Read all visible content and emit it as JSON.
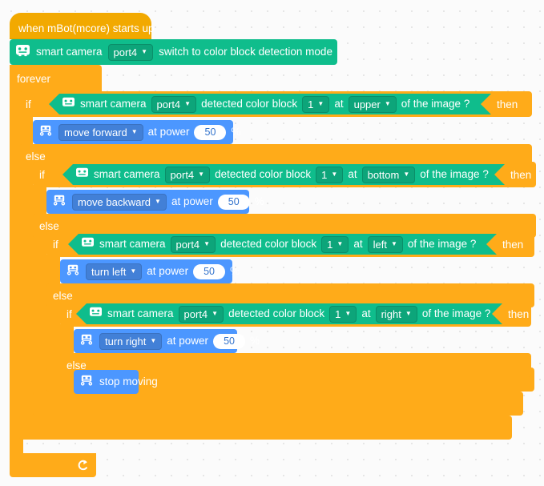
{
  "workspace": {
    "name": "mblock-block-workspace",
    "background": "#fbfbfb",
    "grid_dot_color": "#e2e2e2"
  },
  "colors": {
    "hat_orange": "#F2A900",
    "control_orange": "#FFAB19",
    "sensing_green": "#0FBD8C",
    "sensing_green_field": "#0DA57A",
    "motion_blue": "#4C97FF",
    "motion_blue_field": "#4280D7",
    "number_text": "#3373CC",
    "block_text": "#FFFFFF"
  },
  "script": {
    "hat": {
      "label": "when mBot(mcore) starts up",
      "icon": "none"
    },
    "setup_block": {
      "icon": "smart-camera-icon",
      "device_label": "smart camera",
      "port": "port4",
      "port_caret": "▼",
      "action_label": "switch to color block detection mode"
    },
    "forever": {
      "label": "forever",
      "repeat_icon": "loop-arrow-icon"
    },
    "keywords": {
      "if": "if",
      "then": "then",
      "else": "else",
      "at": "at",
      "of_the_image": "of the image ?",
      "at_power": "at power",
      "percent": "%",
      "detected_color_block": "detected color block"
    },
    "branches": [
      {
        "id": "branch-upper",
        "condition": {
          "icon": "smart-camera-icon",
          "device_label": "smart camera",
          "port": "port4",
          "port_caret": "▼",
          "detect_label": "detected color block",
          "index": "1",
          "index_caret": "▼",
          "at": "at",
          "region": "upper",
          "region_caret": "▼",
          "suffix": "of the image ?"
        },
        "action": {
          "icon": "mbot-move-icon",
          "motion": "move forward",
          "motion_caret": "▼",
          "power_label": "at power",
          "power_value": "50",
          "unit": "%"
        }
      },
      {
        "id": "branch-bottom",
        "condition": {
          "icon": "smart-camera-icon",
          "device_label": "smart camera",
          "port": "port4",
          "port_caret": "▼",
          "detect_label": "detected color block",
          "index": "1",
          "index_caret": "▼",
          "at": "at",
          "region": "bottom",
          "region_caret": "▼",
          "suffix": "of the image ?"
        },
        "action": {
          "icon": "mbot-move-icon",
          "motion": "move backward",
          "motion_caret": "▼",
          "power_label": "at power",
          "power_value": "50",
          "unit": "%"
        }
      },
      {
        "id": "branch-left",
        "condition": {
          "icon": "smart-camera-icon",
          "device_label": "smart camera",
          "port": "port4",
          "port_caret": "▼",
          "detect_label": "detected color block",
          "index": "1",
          "index_caret": "▼",
          "at": "at",
          "region": "left",
          "region_caret": "▼",
          "suffix": "of the image ?"
        },
        "action": {
          "icon": "mbot-move-icon",
          "motion": "turn left",
          "motion_caret": "▼",
          "power_label": "at power",
          "power_value": "50",
          "unit": "%"
        }
      },
      {
        "id": "branch-right",
        "condition": {
          "icon": "smart-camera-icon",
          "device_label": "smart camera",
          "port": "port4",
          "port_caret": "▼",
          "detect_label": "detected color block",
          "index": "1",
          "index_caret": "▼",
          "at": "at",
          "region": "right",
          "region_caret": "▼",
          "suffix": "of the image ?"
        },
        "action": {
          "icon": "mbot-move-icon",
          "motion": "turn right",
          "motion_caret": "▼",
          "power_label": "at power",
          "power_value": "50",
          "unit": "%"
        }
      }
    ],
    "final_else_action": {
      "icon": "mbot-move-icon",
      "label": "stop moving"
    }
  }
}
